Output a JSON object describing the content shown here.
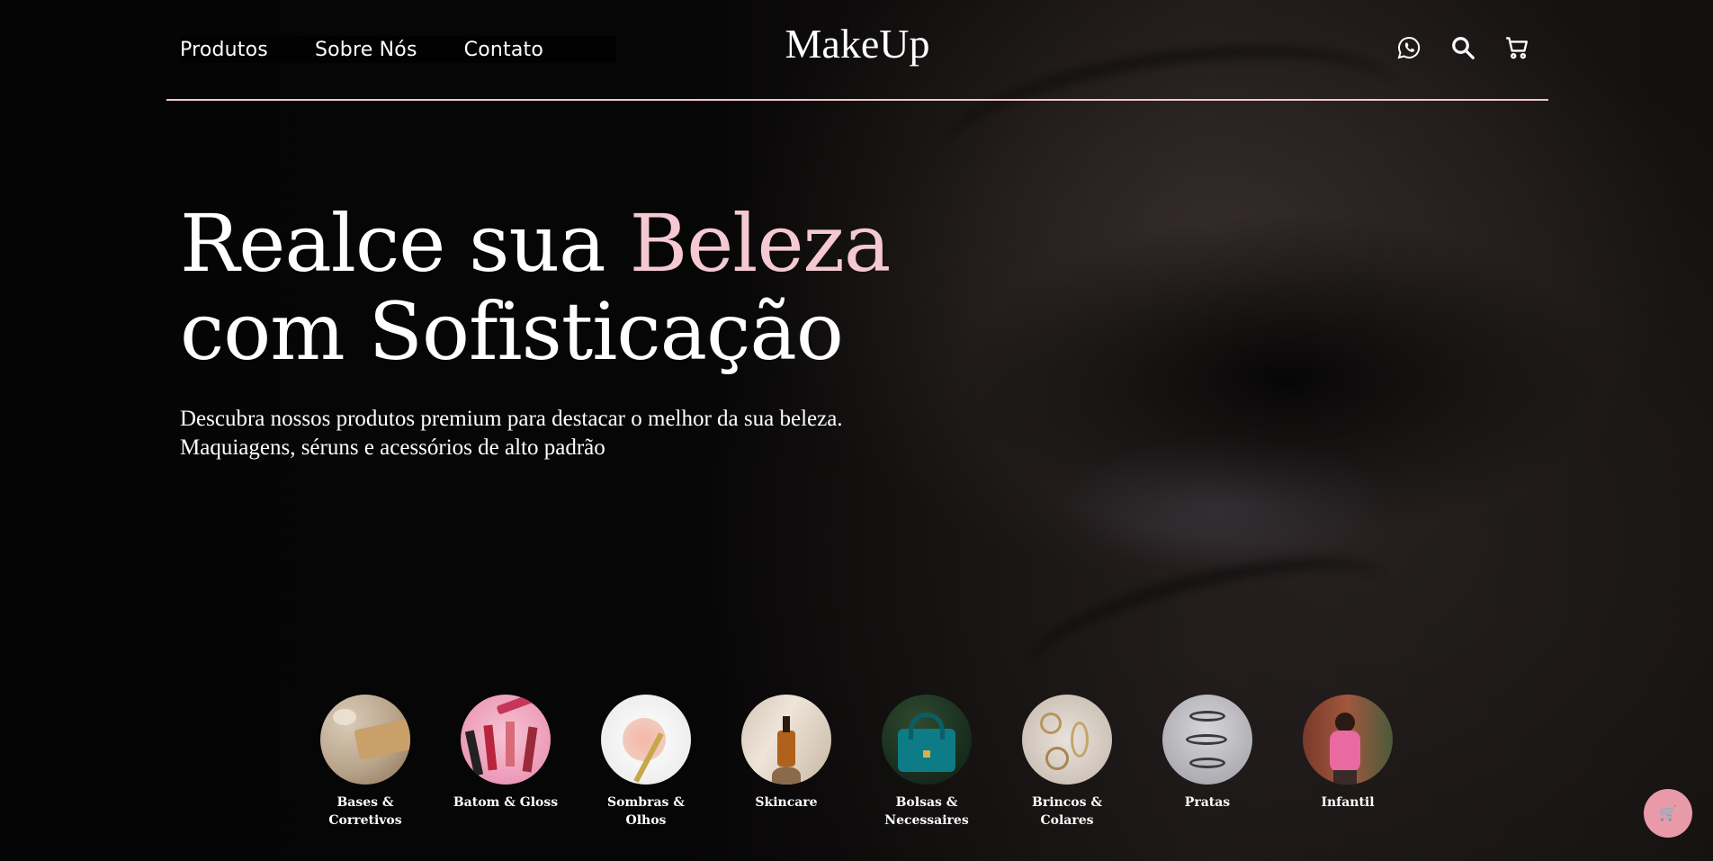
{
  "header": {
    "nav": [
      {
        "label": "Produtos"
      },
      {
        "label": "Sobre Nós"
      },
      {
        "label": "Contato"
      }
    ],
    "logo": "MakeUp",
    "icons": [
      "whatsapp-icon",
      "search-icon",
      "cart-icon"
    ]
  },
  "hero": {
    "headline_part1": "Realce sua ",
    "headline_accent": "Beleza",
    "headline_line2": "com Sofisticação",
    "subtext": "Descubra nossos produtos premium para destacar o melhor da sua beleza. Maquiagens, séruns e acessórios de alto padrão"
  },
  "categories": [
    {
      "label": "Bases & Corretivos"
    },
    {
      "label": "Batom & Gloss"
    },
    {
      "label": "Sombras & Olhos"
    },
    {
      "label": "Skincare"
    },
    {
      "label": "Bolsas & Necessaires"
    },
    {
      "label": "Brincos & Colares"
    },
    {
      "label": "Pratas"
    },
    {
      "label": "Infantil"
    }
  ],
  "colors": {
    "accent": "#f5c9d3",
    "divider": "#f2c6d0",
    "float_button": "#e89aa8"
  },
  "floating_button": {
    "icon": "cart-emoji-icon",
    "glyph": "🛒"
  }
}
